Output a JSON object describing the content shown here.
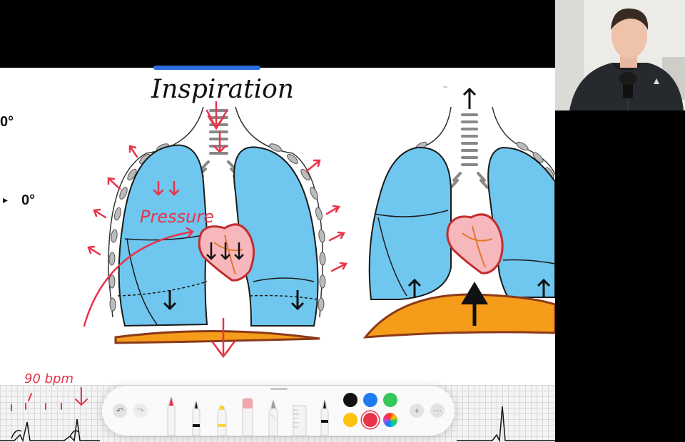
{
  "canvas": {
    "title": "Inspiration",
    "annotation_pressure": "Pressure",
    "heart_rate": "90 bpm",
    "left_marks": [
      "0°",
      "0°"
    ]
  },
  "toolbar": {
    "undo_icon": "undo-icon",
    "redo_icon": "redo-icon",
    "tools": [
      "pen",
      "fine-pen",
      "highlighter",
      "eraser",
      "pencil",
      "ruler",
      "fountain-pen"
    ],
    "colors": [
      "#111111",
      "#1e7cf2",
      "#35c759",
      "#ffc20e",
      "#e8344a",
      "multicolor"
    ],
    "selected_color": "#e8344a",
    "add_icon": "plus-icon",
    "more_icon": "more-icon"
  },
  "colors": {
    "lung": "#6fc6ee",
    "diaphragm": "#f59c1b",
    "diaphragm_edge": "#8b3a1a",
    "annotation": "#e8344a"
  }
}
